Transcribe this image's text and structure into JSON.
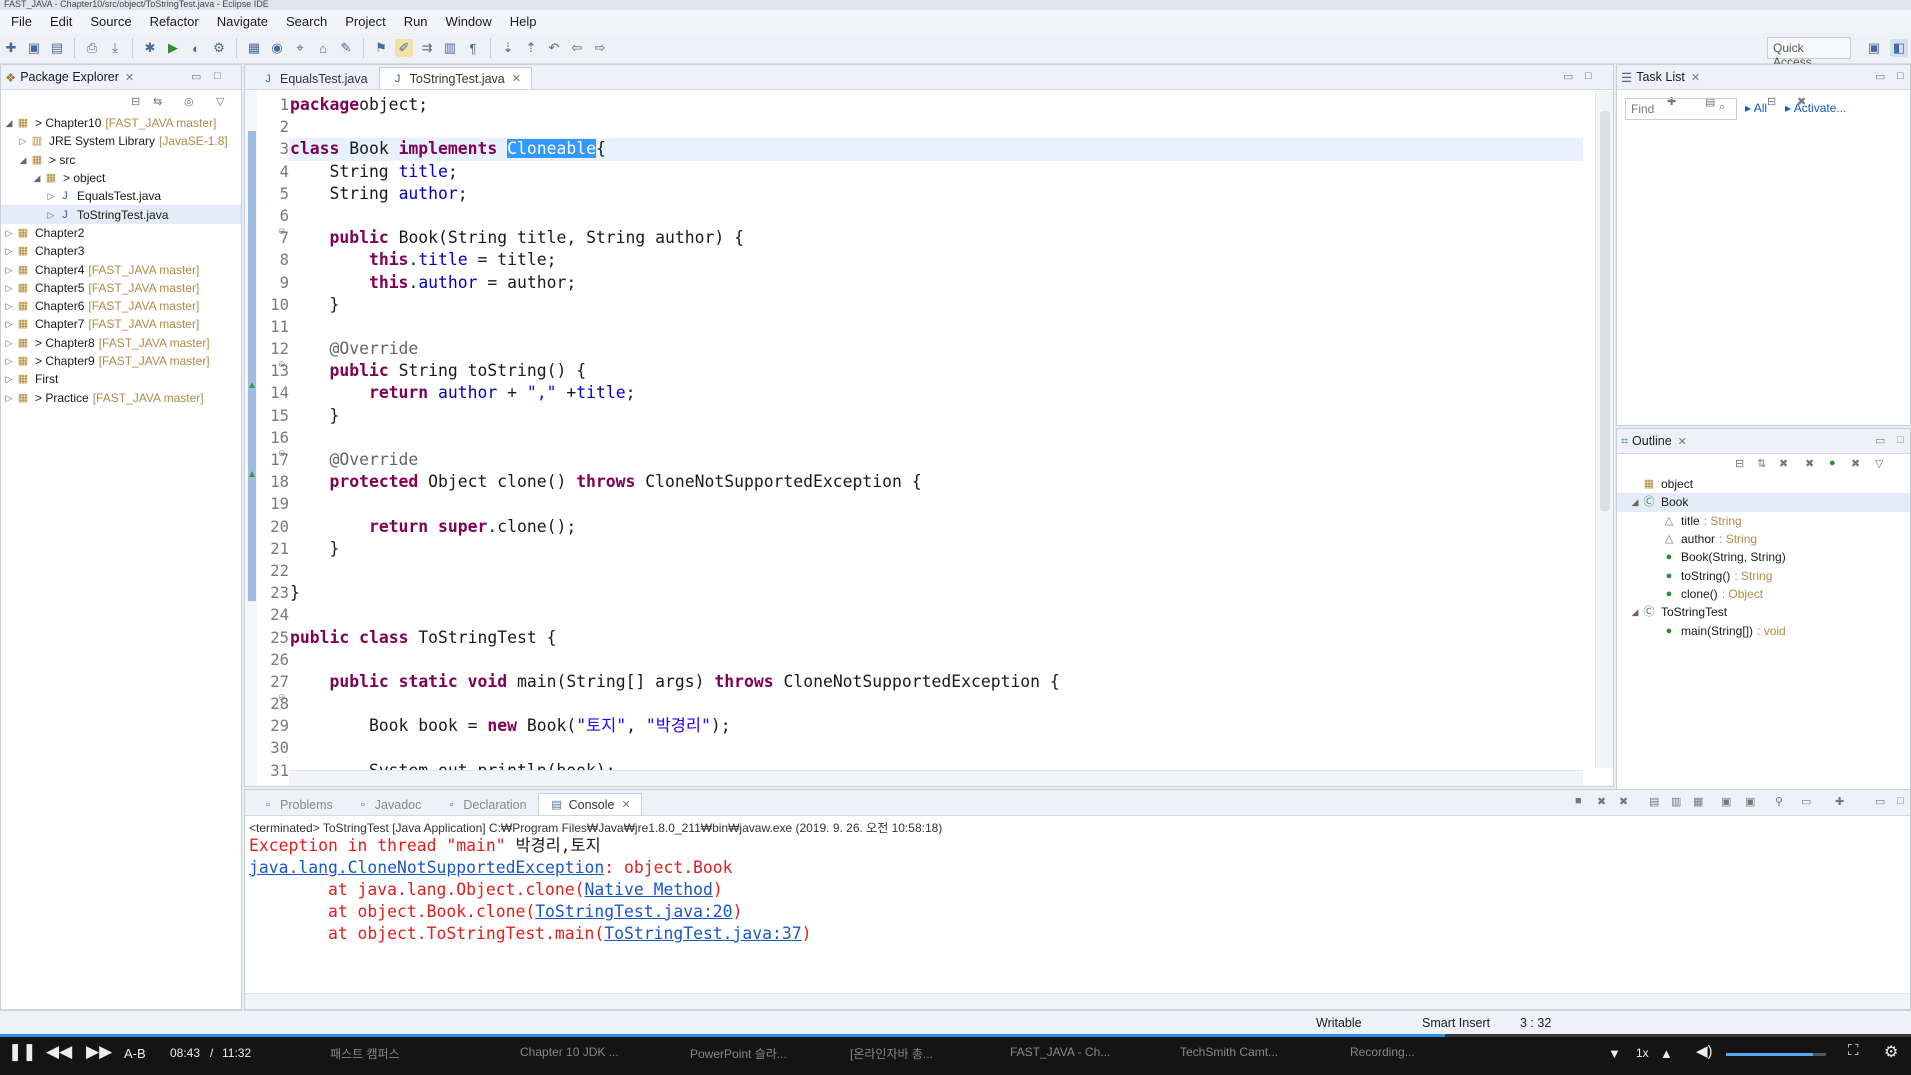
{
  "window": {
    "title": "FAST_JAVA - Chapter10/src/object/ToStringTest.java - Eclipse IDE"
  },
  "menu": [
    "File",
    "Edit",
    "Source",
    "Refactor",
    "Navigate",
    "Search",
    "Project",
    "Run",
    "Window",
    "Help"
  ],
  "toolbar": {
    "quick_access": "Quick Access"
  },
  "package_explorer": {
    "title": "Package Explorer",
    "items": [
      {
        "label": "> Chapter10",
        "decoration": "[FAST_JAVA master]",
        "indent": 0,
        "twisty": "open"
      },
      {
        "label": "JRE System Library",
        "decoration": "[JavaSE-1.8]",
        "indent": 1,
        "twisty": "closed"
      },
      {
        "label": "> src",
        "decoration": "",
        "indent": 1,
        "twisty": "open"
      },
      {
        "label": "> object",
        "decoration": "",
        "indent": 2,
        "twisty": "open"
      },
      {
        "label": "EqualsTest.java",
        "decoration": "",
        "indent": 3,
        "twisty": "closed"
      },
      {
        "label": "ToStringTest.java",
        "decoration": "",
        "indent": 3,
        "twisty": "closed"
      },
      {
        "label": "Chapter2",
        "decoration": "",
        "indent": 0,
        "twisty": "closed"
      },
      {
        "label": "Chapter3",
        "decoration": "",
        "indent": 0,
        "twisty": "closed"
      },
      {
        "label": "Chapter4",
        "decoration": "[FAST_JAVA master]",
        "indent": 0,
        "twisty": "closed"
      },
      {
        "label": "Chapter5",
        "decoration": "[FAST_JAVA master]",
        "indent": 0,
        "twisty": "closed"
      },
      {
        "label": "Chapter6",
        "decoration": "[FAST_JAVA master]",
        "indent": 0,
        "twisty": "closed"
      },
      {
        "label": "Chapter7",
        "decoration": "[FAST_JAVA master]",
        "indent": 0,
        "twisty": "closed"
      },
      {
        "label": "> Chapter8",
        "decoration": "[FAST_JAVA master]",
        "indent": 0,
        "twisty": "closed"
      },
      {
        "label": "> Chapter9",
        "decoration": "[FAST_JAVA master]",
        "indent": 0,
        "twisty": "closed"
      },
      {
        "label": "First",
        "decoration": "",
        "indent": 0,
        "twisty": "closed"
      },
      {
        "label": "> Practice",
        "decoration": "[FAST_JAVA master]",
        "indent": 0,
        "twisty": "closed"
      }
    ]
  },
  "editor": {
    "tabs": [
      {
        "label": "EqualsTest.java",
        "active": false
      },
      {
        "label": "ToStringTest.java",
        "active": true
      }
    ],
    "line_numbers": [
      "1",
      "2",
      "3",
      "4",
      "5",
      "6",
      "7",
      "8",
      "9",
      "10",
      "11",
      "12",
      "13",
      "14",
      "15",
      "16",
      "17",
      "18",
      "19",
      "20",
      "21",
      "22",
      "23",
      "24",
      "25",
      "26",
      "27",
      "28",
      "29",
      "30",
      "31"
    ],
    "code": [
      [
        [
          "kw",
          "package"
        ],
        [
          "",
          "object;"
        ]
      ],
      [],
      [
        [
          "kw",
          "class"
        ],
        [
          "",
          " Book "
        ],
        [
          "kw",
          "implements"
        ],
        [
          "",
          " "
        ],
        [
          "sel",
          "Cloneable"
        ],
        [
          "",
          "{"
        ]
      ],
      [
        [
          "",
          "    String "
        ],
        [
          "fld",
          "title"
        ],
        [
          "",
          ";"
        ]
      ],
      [
        [
          "",
          "    String "
        ],
        [
          "fld",
          "author"
        ],
        [
          "",
          ";"
        ]
      ],
      [],
      [
        [
          "",
          "    "
        ],
        [
          "kw",
          "public"
        ],
        [
          "",
          " Book(String title, String author) {"
        ]
      ],
      [
        [
          "",
          "        "
        ],
        [
          "kw",
          "this"
        ],
        [
          "",
          "."
        ],
        [
          "fld",
          "title"
        ],
        [
          "",
          " = title;"
        ]
      ],
      [
        [
          "",
          "        "
        ],
        [
          "kw",
          "this"
        ],
        [
          "",
          "."
        ],
        [
          "fld",
          "author"
        ],
        [
          "",
          " = author;"
        ]
      ],
      [
        [
          "",
          "    }"
        ]
      ],
      [],
      [
        [
          "",
          "    "
        ],
        [
          "ann",
          "@Override"
        ]
      ],
      [
        [
          "",
          "    "
        ],
        [
          "kw",
          "public"
        ],
        [
          "",
          " String toString() {"
        ]
      ],
      [
        [
          "",
          "        "
        ],
        [
          "kw",
          "return"
        ],
        [
          "",
          " "
        ],
        [
          "fld",
          "author"
        ],
        [
          "",
          " + "
        ],
        [
          "str",
          "\",\""
        ],
        [
          "",
          " +"
        ],
        [
          "fld",
          "title"
        ],
        [
          "",
          ";"
        ]
      ],
      [
        [
          "",
          "    }"
        ]
      ],
      [],
      [
        [
          "",
          "   "
        ],
        [
          "ann",
          " @Override"
        ]
      ],
      [
        [
          "",
          "    "
        ],
        [
          "kw",
          "protected"
        ],
        [
          "",
          " Object clone() "
        ],
        [
          "kw",
          "throws"
        ],
        [
          "",
          " CloneNotSupportedException {"
        ]
      ],
      [],
      [
        [
          "",
          "        "
        ],
        [
          "kw",
          "return"
        ],
        [
          "",
          " "
        ],
        [
          "kw",
          "super"
        ],
        [
          "",
          ".clone();"
        ]
      ],
      [
        [
          "",
          "    }"
        ]
      ],
      [],
      [
        [
          "",
          "}"
        ]
      ],
      [],
      [
        [
          "kw",
          "public"
        ],
        [
          "",
          " "
        ],
        [
          "kw",
          "class"
        ],
        [
          "",
          " ToStringTest {"
        ]
      ],
      [],
      [
        [
          "",
          "    "
        ],
        [
          "kw",
          "public"
        ],
        [
          "",
          " "
        ],
        [
          "kw",
          "static"
        ],
        [
          "",
          " "
        ],
        [
          "kw",
          "void"
        ],
        [
          "",
          " main(String[] args) "
        ],
        [
          "kw",
          "throws"
        ],
        [
          "",
          " CloneNotSupportedException {"
        ]
      ],
      [],
      [
        [
          "",
          "        Book book = "
        ],
        [
          "kw",
          "new"
        ],
        [
          "",
          " Book("
        ],
        [
          "str",
          "\"토지\""
        ],
        [
          "",
          ", "
        ],
        [
          "str",
          "\"박경리\""
        ],
        [
          "",
          ");"
        ]
      ],
      [],
      [
        [
          "",
          "        System.out.println(book);"
        ]
      ]
    ]
  },
  "task_list": {
    "title": "Task List",
    "find_placeholder": "Find",
    "all": "All",
    "activate": "Activate..."
  },
  "outline": {
    "title": "Outline",
    "items": [
      {
        "label": "object",
        "type": "",
        "indent": 0,
        "icon": "package"
      },
      {
        "label": "Book",
        "type": "",
        "indent": 0,
        "icon": "class"
      },
      {
        "label": "title",
        "type": ": String",
        "indent": 1,
        "icon": "field"
      },
      {
        "label": "author",
        "type": ": String",
        "indent": 1,
        "icon": "field"
      },
      {
        "label": "Book(String, String)",
        "type": "",
        "indent": 1,
        "icon": "ctor"
      },
      {
        "label": "toString()",
        "type": ": String",
        "indent": 1,
        "icon": "method"
      },
      {
        "label": "clone()",
        "type": ": Object",
        "indent": 1,
        "icon": "method"
      },
      {
        "label": "ToStringTest",
        "type": "",
        "indent": 0,
        "icon": "class"
      },
      {
        "label": "main(String[])",
        "type": ": void",
        "indent": 1,
        "icon": "method"
      }
    ]
  },
  "console": {
    "tabs": [
      {
        "label": "Problems",
        "active": false
      },
      {
        "label": "Javadoc",
        "active": false
      },
      {
        "label": "Declaration",
        "active": false
      },
      {
        "label": "Console",
        "active": true
      }
    ],
    "header": "<terminated> ToStringTest [Java Application] C:₩Program Files₩Java₩jre1.8.0_211₩bin₩javaw.exe (2019. 9. 26. 오전 10:58:18)",
    "lines": [
      [
        [
          "err",
          "Exception in thread \"main\" "
        ],
        [
          "",
          "박경리,토지"
        ]
      ],
      [
        [
          "link",
          "java.lang.CloneNotSupportedException"
        ],
        [
          "err",
          ": object.Book"
        ]
      ],
      [
        [
          "err",
          "\tat java.lang.Object.clone("
        ],
        [
          "link",
          "Native Method"
        ],
        [
          "err",
          ")"
        ]
      ],
      [
        [
          "err",
          "\tat object.Book.clone("
        ],
        [
          "link",
          "ToStringTest.java:20"
        ],
        [
          "err",
          ")"
        ]
      ],
      [
        [
          "err",
          "\tat object.ToStringTest.main("
        ],
        [
          "link",
          "ToStringTest.java:37"
        ],
        [
          "err",
          ")"
        ]
      ]
    ]
  },
  "status": {
    "writable": "Writable",
    "insert_mode": "Smart Insert",
    "position": "3 : 32"
  },
  "player": {
    "ab": "A-B",
    "current": "08:43",
    "separator": "/",
    "total": "11:32",
    "speed": "1x",
    "progress_fraction": 0.756,
    "volume_fraction": 0.87
  },
  "taskbar": [
    "패스트 캠퍼스",
    "Chapter 10 JDK ...",
    "PowerPoint 슬라...",
    "[온라인자바 총...",
    "FAST_JAVA - Ch...",
    "TechSmith Camt...",
    "Recording..."
  ],
  "colors": {
    "keyword": "#7f0055",
    "field": "#0000c0",
    "string": "#2a00ff",
    "error": "#e0201d",
    "link": "#1a57c7",
    "selection": "#3399ff"
  }
}
